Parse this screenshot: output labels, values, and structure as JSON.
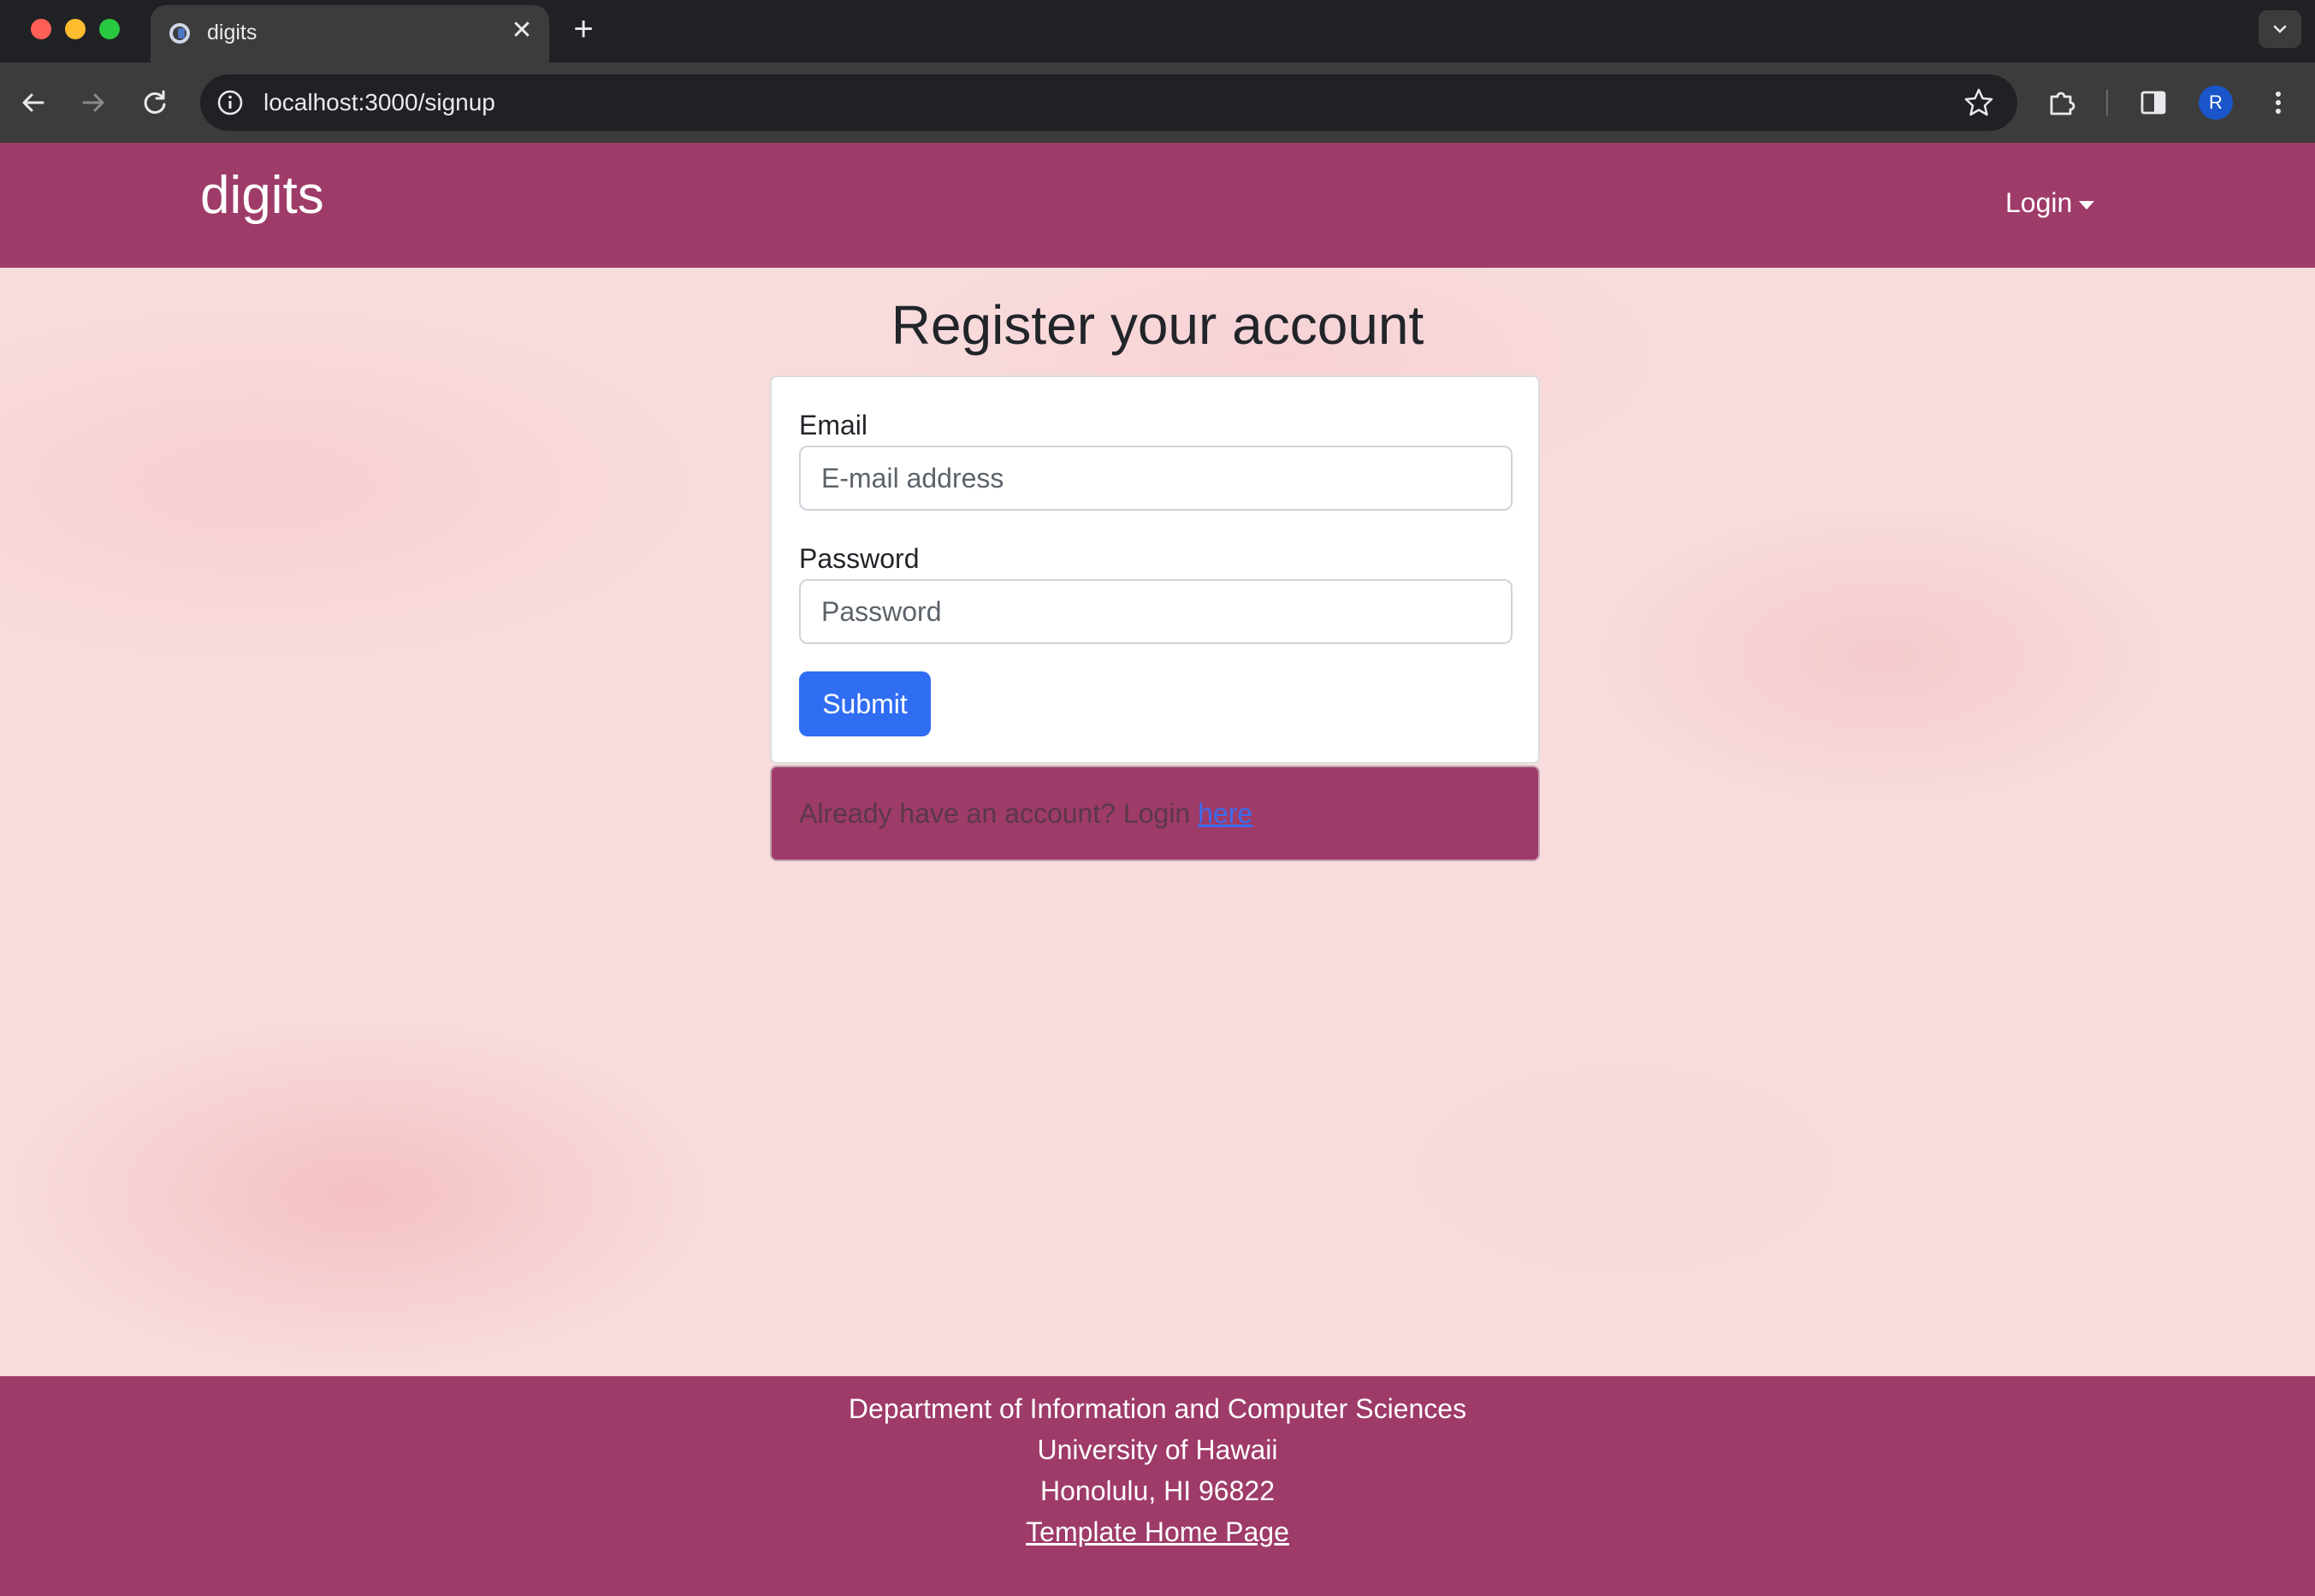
{
  "browser": {
    "tab_title": "digits",
    "new_tab_symbol": "+",
    "close_symbol": "✕",
    "url": "localhost:3000/signup",
    "profile_initial": "R"
  },
  "navbar": {
    "brand": "digits",
    "login_label": "Login"
  },
  "main": {
    "heading": "Register your account",
    "email_label": "Email",
    "email_placeholder": "E-mail address",
    "password_label": "Password",
    "password_placeholder": "Password",
    "submit_label": "Submit",
    "alert_text": "Already have an account? Login ",
    "alert_link": "here"
  },
  "footer": {
    "line1": "Department of Information and Computer Sciences",
    "line2": "University of Hawaii",
    "line3": "Honolulu, HI 96822",
    "link": "Template Home Page"
  },
  "colors": {
    "brand": "#9e3b68",
    "primary_button": "#2f6df2",
    "page_background": "#f8dcdd"
  }
}
